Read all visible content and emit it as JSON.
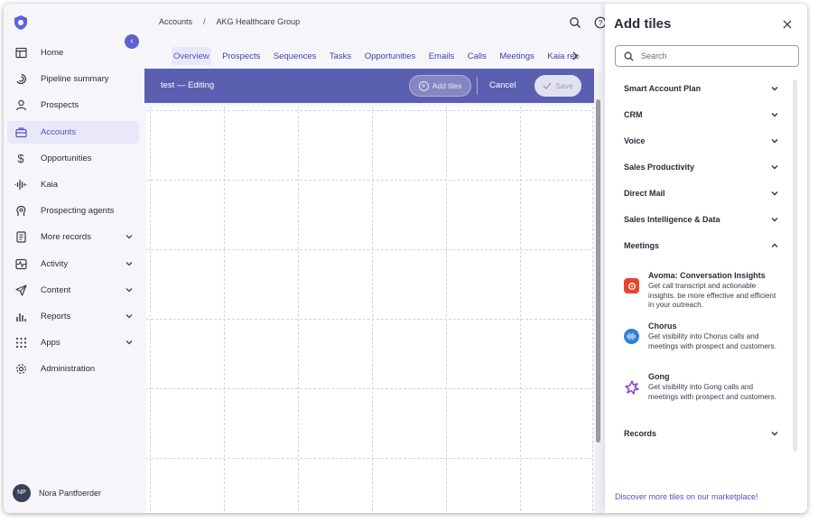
{
  "sidebar": {
    "items": [
      {
        "label": "Home",
        "icon": "home-icon",
        "expandable": false
      },
      {
        "label": "Pipeline summary",
        "icon": "pipeline-icon",
        "expandable": false
      },
      {
        "label": "Prospects",
        "icon": "person-icon",
        "expandable": false
      },
      {
        "label": "Accounts",
        "icon": "briefcase-icon",
        "expandable": false,
        "active": true
      },
      {
        "label": "Opportunities",
        "icon": "dollar-icon",
        "expandable": false
      },
      {
        "label": "Kaia",
        "icon": "waveform-icon",
        "expandable": false
      },
      {
        "label": "Prospecting agents",
        "icon": "agent-icon",
        "expandable": false
      },
      {
        "label": "More records",
        "icon": "document-icon",
        "expandable": true
      },
      {
        "label": "Activity",
        "icon": "activity-icon",
        "expandable": true
      },
      {
        "label": "Content",
        "icon": "send-icon",
        "expandable": true
      },
      {
        "label": "Reports",
        "icon": "bar-chart-icon",
        "expandable": true
      },
      {
        "label": "Apps",
        "icon": "grid-dots-icon",
        "expandable": true
      },
      {
        "label": "Administration",
        "icon": "gear-icon",
        "expandable": false
      }
    ],
    "user": {
      "initials": "NP",
      "name": "Nora Pantfoerder"
    }
  },
  "breadcrumb": {
    "parent": "Accounts",
    "separator": "/",
    "current": "AKG Healthcare Group"
  },
  "tabs": [
    "Overview",
    "Prospects",
    "Sequences",
    "Tasks",
    "Opportunities",
    "Emails",
    "Calls",
    "Meetings",
    "Kaia recordings"
  ],
  "editbar": {
    "title": "test — Editing",
    "add_tiles": "Add tiles",
    "cancel": "Cancel",
    "save": "Save"
  },
  "panel": {
    "title": "Add tiles",
    "search_placeholder": "Search",
    "categories": [
      {
        "label": "Smart Account Plan",
        "expanded": false
      },
      {
        "label": "CRM",
        "expanded": false
      },
      {
        "label": "Voice",
        "expanded": false
      },
      {
        "label": "Sales Productivity",
        "expanded": false
      },
      {
        "label": "Direct Mail",
        "expanded": false
      },
      {
        "label": "Sales Intelligence & Data",
        "expanded": false
      },
      {
        "label": "Meetings",
        "expanded": true
      }
    ],
    "tiles": [
      {
        "title": "Avoma: Conversation Insights",
        "desc": "Get call transcript and actionable insights. be more effective and efficient in your outreach.",
        "icon": "avoma-icon",
        "color": "#e8452c"
      },
      {
        "title": "Chorus",
        "desc": "Get visibility into Chorus calls and meetings with prospect and customers.",
        "icon": "chorus-icon",
        "color": "#2e7fd6"
      },
      {
        "title": "Gong",
        "desc": "Get visibility into Gong calls and meetings with prospect and customers.",
        "icon": "gong-icon",
        "color": "#8c3fd9"
      }
    ],
    "records_label": "Records",
    "marketplace_link": "Discover more tiles on our marketplace!"
  },
  "colors": {
    "accent": "#4c55c4",
    "editbar": "#5b5fb0"
  }
}
